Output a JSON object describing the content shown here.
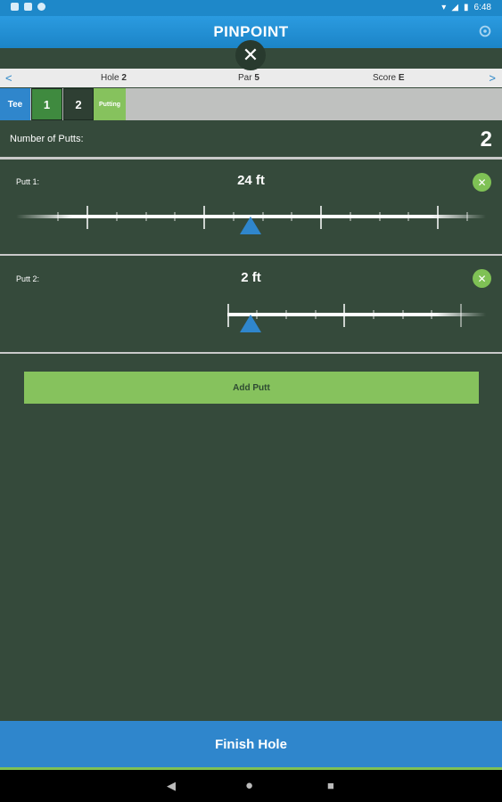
{
  "status": {
    "time": "6:48"
  },
  "app": {
    "title": "PINPOINT"
  },
  "hole": {
    "hole_label": "Hole",
    "hole_value": "2",
    "par_label": "Par",
    "par_value": "5",
    "score_label": "Score",
    "score_value": "E"
  },
  "shots": [
    {
      "label": "Tee",
      "color": "#2f86cc"
    },
    {
      "label": "1",
      "color": "#3f8a3f"
    },
    {
      "label": "2",
      "color": "#2e3f33"
    },
    {
      "label": "Putting",
      "color": "#86c25d"
    }
  ],
  "putts_summary": {
    "label": "Number of Putts:",
    "count": "2"
  },
  "putts": [
    {
      "label": "Putt 1:",
      "distance": "24 ft",
      "value_ft": 24
    },
    {
      "label": "Putt 2:",
      "distance": "2 ft",
      "value_ft": 2
    }
  ],
  "actions": {
    "add_putt": "Add Putt",
    "finish_hole": "Finish Hole"
  },
  "colors": {
    "accent": "#2f86cc",
    "green": "#86c25d",
    "background": "#354a3b"
  }
}
